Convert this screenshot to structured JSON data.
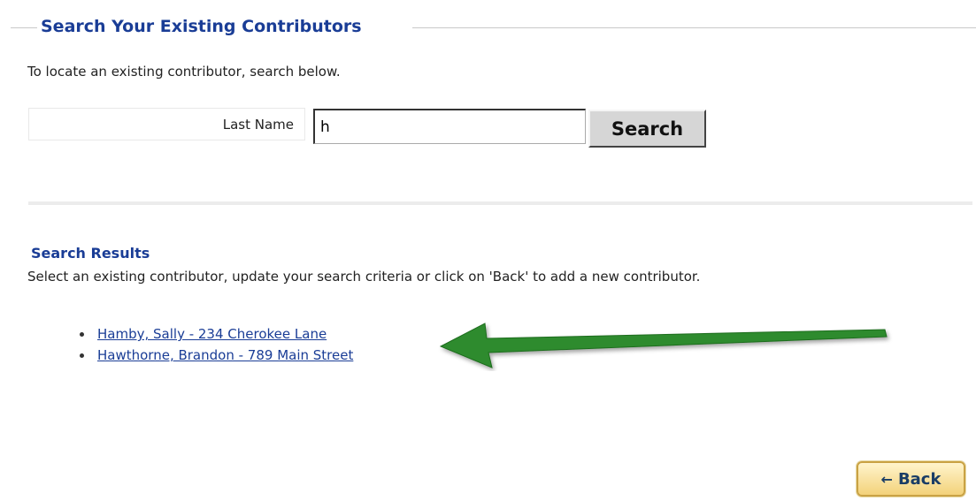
{
  "section": {
    "title": "Search Your Existing Contributors",
    "intro": "To locate an existing contributor, search below."
  },
  "search": {
    "label": "Last Name",
    "value": "h",
    "button_label": "Search"
  },
  "results": {
    "title": "Search Results",
    "instructions": "Select an existing contributor, update your search criteria or click on 'Back' to add a new contributor.",
    "items": [
      {
        "label": "Hamby, Sally - 234 Cherokee Lane"
      },
      {
        "label": "Hawthorne, Brandon - 789 Main Street"
      }
    ]
  },
  "back_button": {
    "label": "Back",
    "icon": "arrow-left-icon"
  },
  "colors": {
    "heading": "#1a3d96",
    "annotation_arrow": "#2e8b2e",
    "back_button_fill": "#f3d27a"
  }
}
